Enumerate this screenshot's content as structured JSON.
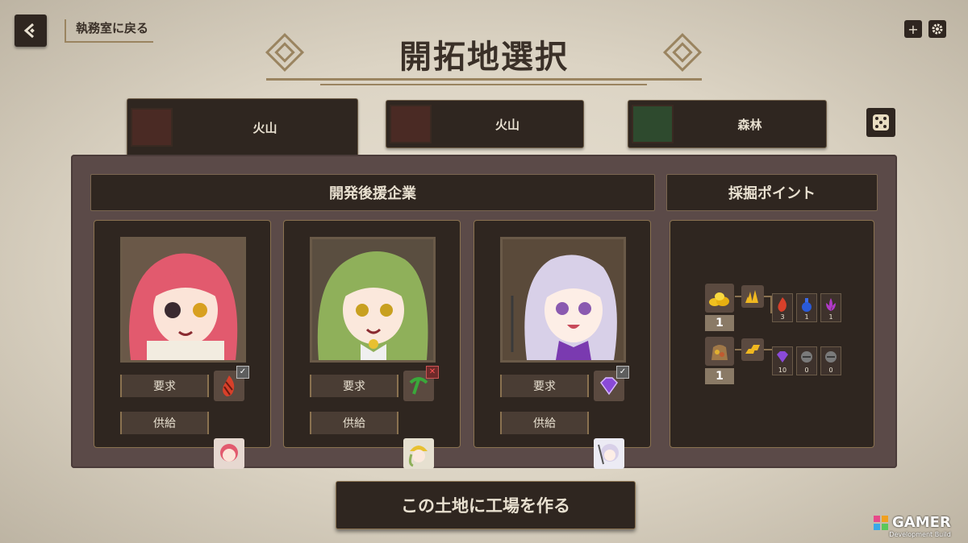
{
  "header": {
    "back_label": "執務室に戻る",
    "title": "開拓地選択",
    "plus_label": "+"
  },
  "tabs": [
    {
      "label": "火山",
      "thumb_color": "#4a2a24",
      "active": true
    },
    {
      "label": "火山",
      "thumb_color": "#4a2a24",
      "active": false
    },
    {
      "label": "森林",
      "thumb_color": "#2e4a2e",
      "active": false
    }
  ],
  "companies": {
    "header": "開発後援企業",
    "cards": [
      {
        "request_label": "要求",
        "supply_label": "供給",
        "resource_icon": "flame-icon",
        "status": "ok",
        "hair": "#e25a6e"
      },
      {
        "request_label": "要求",
        "supply_label": "供給",
        "resource_icon": "pickaxe-icon",
        "status": "ng",
        "hair": "#8fb05a"
      },
      {
        "request_label": "要求",
        "supply_label": "供給",
        "resource_icon": "gem-icon",
        "status": "ok",
        "hair": "#d8d0e8"
      }
    ]
  },
  "mining": {
    "header": "採掘ポイント",
    "points": [
      {
        "count": "1",
        "source_icon": "gold-pile-icon",
        "rewards": [
          {
            "icon": "flame-icon",
            "value": "3"
          },
          {
            "icon": "potion-icon",
            "value": "1"
          },
          {
            "icon": "lotus-icon",
            "value": "1"
          }
        ]
      },
      {
        "count": "1",
        "source_icon": "ore-sack-icon",
        "rewards": [
          {
            "icon": "gem-icon",
            "value": "10"
          },
          {
            "icon": "empty-slot-icon",
            "value": "0"
          },
          {
            "icon": "empty-slot-icon",
            "value": "0"
          }
        ]
      }
    ]
  },
  "cta_label": "この土地に工場を作る",
  "watermark": {
    "brand": "GAMER",
    "sub": "Development Build"
  },
  "colors": {
    "panel": "#5b4a48",
    "dark": "#2f2620",
    "gold": "#9a8460"
  }
}
